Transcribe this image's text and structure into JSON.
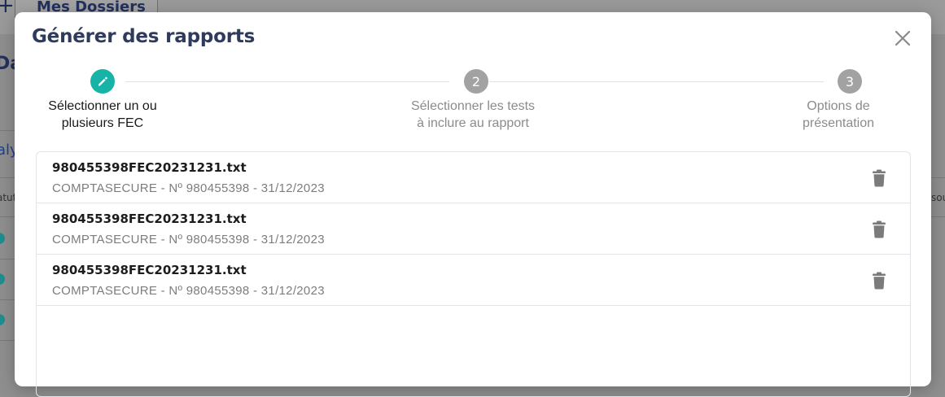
{
  "background": {
    "plus": "+",
    "tab_label": "Mes Dossiers",
    "heading_fragment": "Da",
    "link_fragment": "aly",
    "column_left_fragment": "atut",
    "column_right_fragment": "sou"
  },
  "modal": {
    "title": "Générer des rapports",
    "close_icon": "close-icon"
  },
  "steps": [
    {
      "number": "1",
      "icon": "pencil-icon",
      "label_line1": "Sélectionner un ou",
      "label_line2": "plusieurs FEC",
      "state": "active"
    },
    {
      "number": "2",
      "label_line1": "Sélectionner les tests",
      "label_line2": "à inclure au rapport",
      "state": "inactive"
    },
    {
      "number": "3",
      "label_line1": "Options de",
      "label_line2": "présentation",
      "state": "inactive"
    }
  ],
  "files": [
    {
      "name": "980455398FEC20231231.txt",
      "meta": "COMPTASECURE - Nº 980455398 - 31/12/2023",
      "action_icon": "trash-icon"
    },
    {
      "name": "980455398FEC20231231.txt",
      "meta": "COMPTASECURE - Nº 980455398 - 31/12/2023",
      "action_icon": "trash-icon"
    },
    {
      "name": "980455398FEC20231231.txt",
      "meta": "COMPTASECURE - Nº 980455398 - 31/12/2023",
      "action_icon": "trash-icon"
    }
  ],
  "colors": {
    "accent": "#17b3a6",
    "title": "#2f3b5c",
    "inactive_step": "#a2a2a2"
  }
}
